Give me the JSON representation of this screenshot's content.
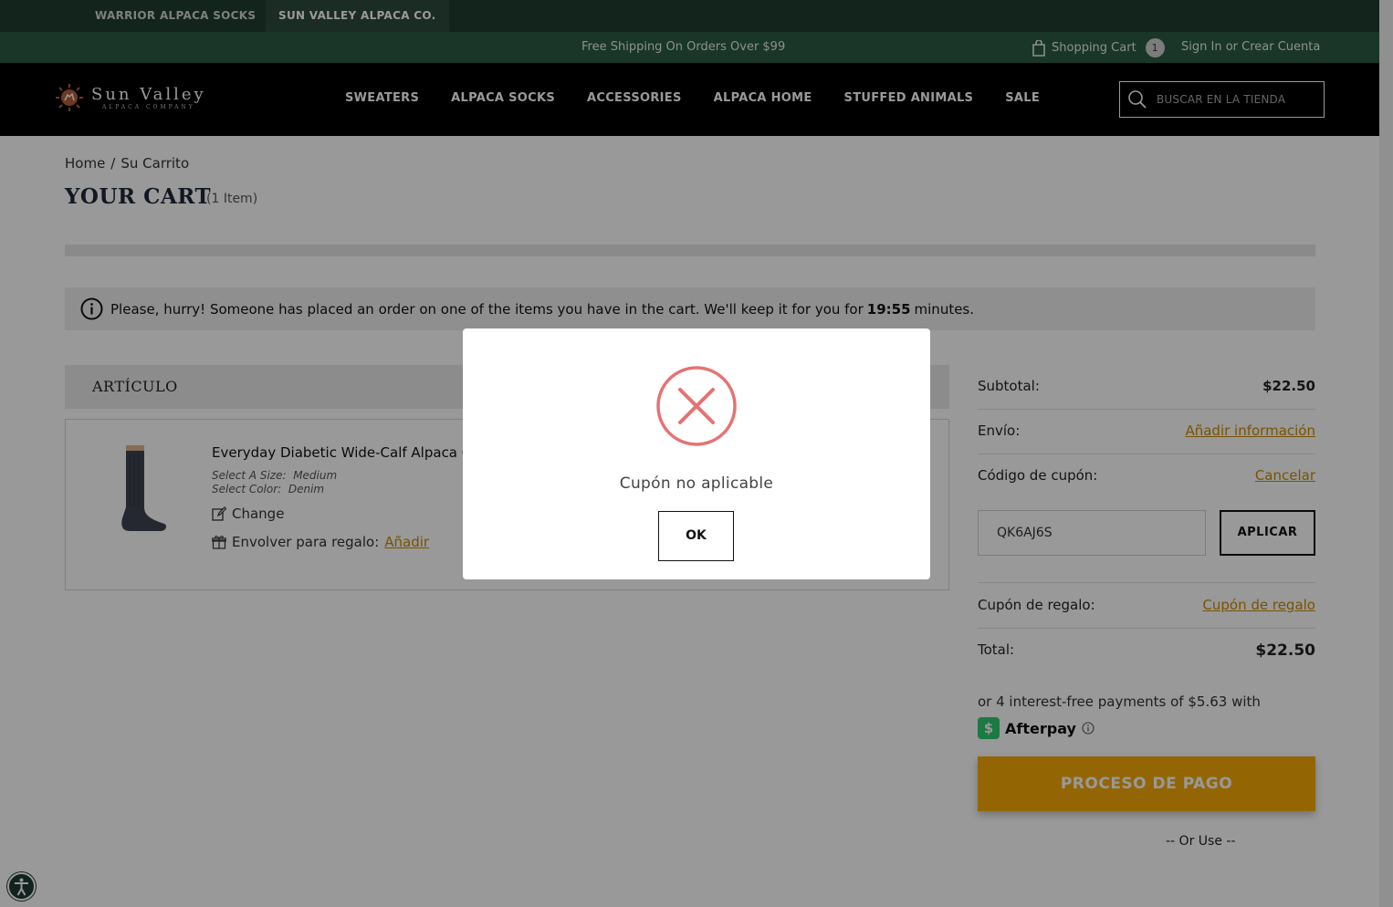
{
  "store_tabs": [
    "WARRIOR ALPACA SOCKS",
    "SUN VALLEY ALPACA CO."
  ],
  "announcement": {
    "free_shipping": "Free Shipping On Orders Over $99",
    "cart_label": "Shopping Cart",
    "cart_count": "1",
    "signin": "Sign In or Crear Cuenta"
  },
  "logo": {
    "name": "Sun Valley",
    "tagline": "ALPACA COMPANY"
  },
  "nav": [
    "SWEATERS",
    "ALPACA SOCKS",
    "ACCESSORIES",
    "ALPACA HOME",
    "STUFFED ANIMALS",
    "SALE"
  ],
  "search": {
    "placeholder": "BUSCAR EN LA TIENDA"
  },
  "breadcrumb": {
    "home": "Home",
    "separator": "/",
    "current": "Su Carrito"
  },
  "page": {
    "title": "YOUR CART",
    "count": "(1 Item)"
  },
  "hurry": {
    "text_before": "Please, hurry! Someone has placed an order on one of the items you have in the cart. We'll keep it for you for",
    "time": "19:55",
    "text_after": "minutes."
  },
  "table": {
    "header": "ARTÍCULO"
  },
  "item": {
    "name": "Everyday Diabetic Wide-Calf Alpaca Crew Socks",
    "size_label": "Select A Size:",
    "size": "Medium",
    "color_label": "Select Color:",
    "color": "Denim",
    "change": "Change",
    "gift_label": "Envolver para regalo:",
    "gift_link": "Añadir"
  },
  "summary": {
    "subtotal_label": "Subtotal:",
    "subtotal": "$22.50",
    "shipping_label": "Envío:",
    "shipping_link": "Añadir información",
    "coupon_label": "Código de cupón:",
    "coupon_cancel": "Cancelar",
    "coupon_value": "QK6AJ6S",
    "apply": "APLICAR",
    "gift_label": "Cupón de regalo:",
    "gift_link": "Cupón de regalo",
    "total_label": "Total:",
    "total": "$22.50",
    "afterpay_text": "or 4 interest-free payments of $5.63 with",
    "afterpay_name": "Afterpay",
    "checkout": "PROCESO DE PAGO",
    "or_use": "-- Or Use --"
  },
  "modal": {
    "message": "Cupón no aplicable",
    "ok": "OK"
  },
  "colors": {
    "accent_gold": "#f5aa06",
    "link_gold": "#c98a00",
    "header_green": "#1e3d30",
    "error_red": "#e57373"
  }
}
